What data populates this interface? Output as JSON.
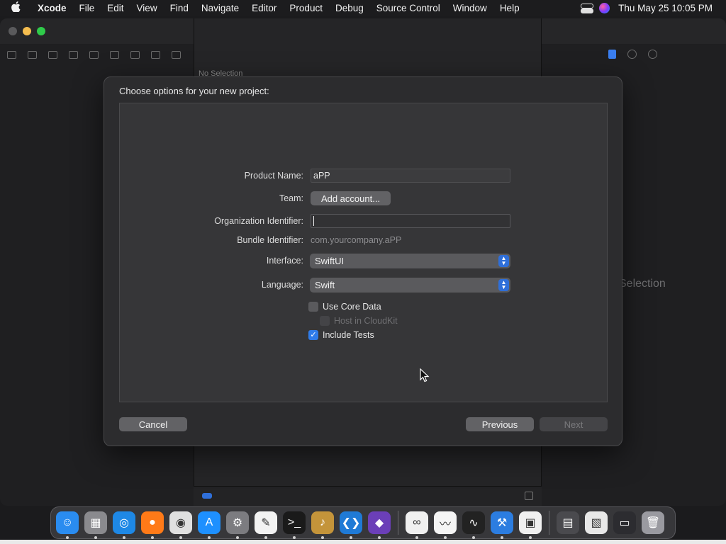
{
  "menubar": {
    "apple": "",
    "app_name": "Xcode",
    "items": [
      "File",
      "Edit",
      "View",
      "Find",
      "Navigate",
      "Editor",
      "Product",
      "Debug",
      "Source Control",
      "Window",
      "Help"
    ],
    "clock": "Thu May 25  10:05 PM"
  },
  "window": {
    "top_status": "No Selection",
    "inspector_status": "Selection"
  },
  "dialog": {
    "title": "Choose options for your new project:",
    "fields": {
      "product_name": {
        "label": "Product Name:",
        "value": "aPP"
      },
      "team": {
        "label": "Team:",
        "button": "Add account..."
      },
      "org_identifier": {
        "label": "Organization Identifier:",
        "value": ""
      },
      "bundle_identifier": {
        "label": "Bundle Identifier:",
        "value": "com.yourcompany.aPP"
      },
      "interface": {
        "label": "Interface:",
        "value": "SwiftUI"
      },
      "language": {
        "label": "Language:",
        "value": "Swift"
      }
    },
    "checkboxes": {
      "use_core_data": {
        "label": "Use Core Data",
        "checked": false,
        "enabled": true
      },
      "host_in_cloudkit": {
        "label": "Host in CloudKit",
        "checked": false,
        "enabled": false
      },
      "include_tests": {
        "label": "Include Tests",
        "checked": true,
        "enabled": true
      }
    },
    "buttons": {
      "cancel": "Cancel",
      "previous": "Previous",
      "next": "Next"
    }
  },
  "dock": {
    "apps": [
      {
        "name": "finder-icon",
        "color": "#2a8cf0",
        "glyph": "☺"
      },
      {
        "name": "launchpad-icon",
        "color": "#8a8a8e",
        "glyph": "▦"
      },
      {
        "name": "safari-icon",
        "color": "#1e88e5",
        "glyph": "◎"
      },
      {
        "name": "firefox-icon",
        "color": "#ff7a18",
        "glyph": "●"
      },
      {
        "name": "chrome-icon",
        "color": "#e0e0e0",
        "glyph": "◉"
      },
      {
        "name": "app-store-icon",
        "color": "#1e90ff",
        "glyph": "A"
      },
      {
        "name": "system-settings-icon",
        "color": "#7c7c80",
        "glyph": "⚙"
      },
      {
        "name": "textedit-icon",
        "color": "#f3f3f3",
        "glyph": "✎"
      },
      {
        "name": "terminal-icon",
        "color": "#1a1a1a",
        "glyph": ">_"
      },
      {
        "name": "instruments-icon",
        "color": "#c4943a",
        "glyph": "♪"
      },
      {
        "name": "vscode-icon",
        "color": "#1f7ad6",
        "glyph": "❮❯"
      },
      {
        "name": "visual-studio-icon",
        "color": "#6b3fb8",
        "glyph": "◆"
      }
    ],
    "apps_after_sep": [
      {
        "name": "network-tool-icon",
        "color": "#f0f0f0",
        "glyph": "∞"
      },
      {
        "name": "freeform-icon",
        "color": "#f5f5f5",
        "glyph": "〰"
      },
      {
        "name": "activity-monitor-icon",
        "color": "#222222",
        "glyph": "∿"
      },
      {
        "name": "xcode-icon",
        "color": "#2c7de0",
        "glyph": "⚒"
      },
      {
        "name": "simulator-icon",
        "color": "#f0f0f0",
        "glyph": "▣"
      }
    ],
    "recent": [
      {
        "name": "recent-window-icon-1",
        "color": "#4a4a4e",
        "glyph": "▤"
      },
      {
        "name": "recent-window-icon-2",
        "color": "#e8e8e8",
        "glyph": "▧"
      },
      {
        "name": "recent-window-icon-3",
        "color": "#2c2c30",
        "glyph": "▭"
      },
      {
        "name": "trash-icon",
        "color": "#9a9aa0",
        "glyph": "🗑"
      }
    ]
  }
}
